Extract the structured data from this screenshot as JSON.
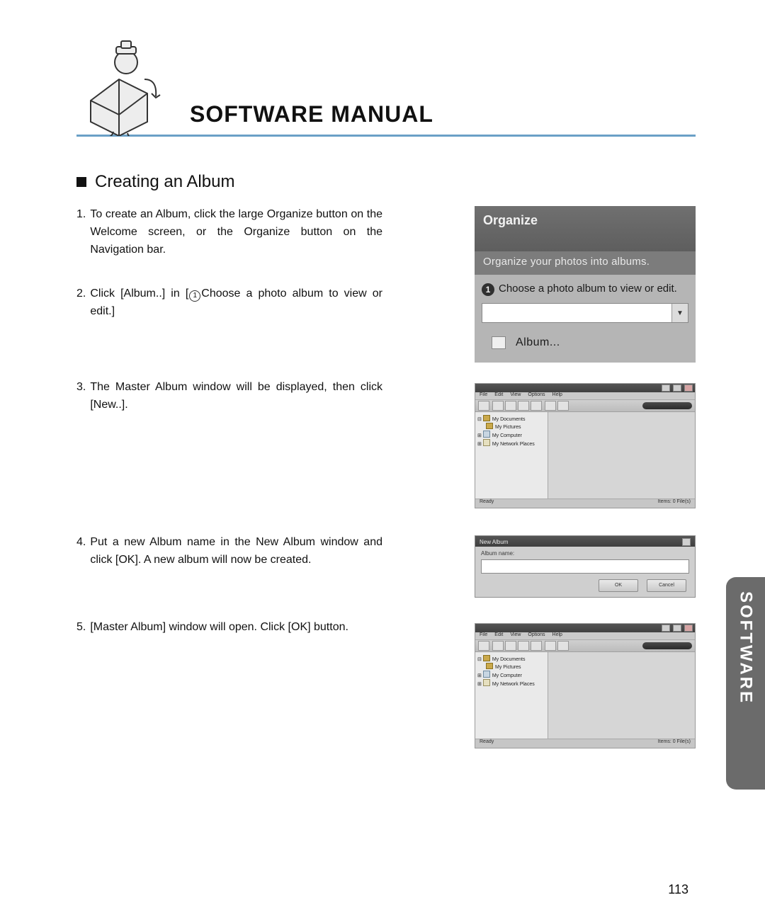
{
  "header": {
    "title": "SOFTWARE MANUAL"
  },
  "section": {
    "heading": "Creating an Album"
  },
  "steps": {
    "s1": {
      "num": "1.",
      "text": "To create an Album, click the large Organize button on the Welcome screen, or the Organize button on the Navigation bar."
    },
    "s2": {
      "num": "2.",
      "text_pre": "Click [Album..] in [",
      "text_post": "Choose a photo album to view or edit.]",
      "icon_text": "1"
    },
    "s3": {
      "num": "3.",
      "text": "The Master Album window will be displayed, then click [New..]."
    },
    "s4": {
      "num": "4.",
      "text": "Put a new Album name in the New Album window and click [OK]. A new album will now be created."
    },
    "s5": {
      "num": "5.",
      "text": "[Master Album] window will open. Click [OK] button."
    }
  },
  "organize": {
    "title": "Organize",
    "subtitle": "Organize your photos into albums.",
    "badge": "1",
    "prompt": "Choose a photo album to view or edit.",
    "album_label": "Album..."
  },
  "app_window": {
    "menu": [
      "File",
      "Edit",
      "View",
      "Options",
      "Help"
    ],
    "tree": {
      "n1": "My Documents",
      "n2": "My Pictures",
      "n3": "My Computer",
      "n4": "My Network Places"
    },
    "status_left": "Ready",
    "status_right": "Items: 0 File(s)"
  },
  "dialog": {
    "title": "New Album",
    "label": "Album name:",
    "ok": "OK",
    "cancel": "Cancel"
  },
  "side_tab": "SOFTWARE",
  "page_number": "113"
}
